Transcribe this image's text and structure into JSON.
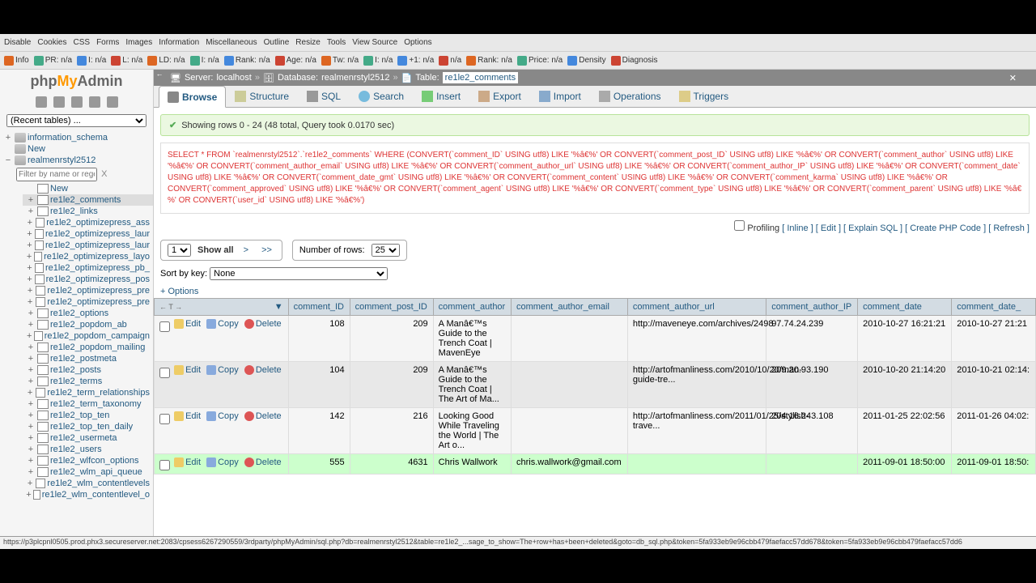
{
  "toolbar1": [
    "Disable",
    "Cookies",
    "CSS",
    "Forms",
    "Images",
    "Information",
    "Miscellaneous",
    "Outline",
    "Resize",
    "Tools",
    "View Source",
    "Options"
  ],
  "toolbar2": [
    {
      "label": "Info"
    },
    {
      "label": "PR: n/a"
    },
    {
      "label": "I: n/a"
    },
    {
      "label": "L: n/a"
    },
    {
      "label": "LD: n/a"
    },
    {
      "label": "I: n/a"
    },
    {
      "label": "Rank: n/a"
    },
    {
      "label": "Age: n/a"
    },
    {
      "label": "Tw: n/a"
    },
    {
      "label": "I: n/a"
    },
    {
      "label": "+1: n/a"
    },
    {
      "label": "n/a"
    },
    {
      "label": "Rank: n/a"
    },
    {
      "label": "Price: n/a"
    },
    {
      "label": "Density"
    },
    {
      "label": "Diagnosis"
    }
  ],
  "logo": {
    "php": "php",
    "my": "My",
    "admin": "Admin"
  },
  "recent_tables": "(Recent tables) ...",
  "tree": {
    "root": [
      {
        "label": "information_schema",
        "kind": "db"
      },
      {
        "label": "New",
        "kind": "new"
      },
      {
        "label": "realmenrstyl2512",
        "kind": "db",
        "expanded": true
      }
    ],
    "filter_placeholder": "Filter by name or regex",
    "filter_x": "X",
    "sub_new": "New",
    "tables": [
      "re1le2_comments",
      "re1le2_links",
      "re1le2_optimizepress_ass",
      "re1le2_optimizepress_laur",
      "re1le2_optimizepress_laur",
      "re1le2_optimizepress_layo",
      "re1le2_optimizepress_pb_",
      "re1le2_optimizepress_pos",
      "re1le2_optimizepress_pre",
      "re1le2_optimizepress_pre",
      "re1le2_options",
      "re1le2_popdom_ab",
      "re1le2_popdom_campaign",
      "re1le2_popdom_mailing",
      "re1le2_postmeta",
      "re1le2_posts",
      "re1le2_terms",
      "re1le2_term_relationships",
      "re1le2_term_taxonomy",
      "re1le2_top_ten",
      "re1le2_top_ten_daily",
      "re1le2_usermeta",
      "re1le2_users",
      "re1le2_wlfcon_options",
      "re1le2_wlm_api_queue",
      "re1le2_wlm_contentlevels",
      "re1le2_wlm_contentlevel_o"
    ],
    "selected": "re1le2_comments"
  },
  "breadcrumb": {
    "server_label": "Server:",
    "server": "localhost",
    "db_label": "Database:",
    "db": "realmenrstyl2512",
    "table_label": "Table:",
    "table": "re1le2_comments"
  },
  "tabs": [
    "Browse",
    "Structure",
    "SQL",
    "Search",
    "Insert",
    "Export",
    "Import",
    "Operations",
    "Triggers"
  ],
  "tab_active": "Browse",
  "success_msg": "Showing rows 0 - 24 (48 total, Query took 0.0170 sec)",
  "sql_query": "SELECT * FROM `realmenrstyl2512`.`re1le2_comments` WHERE (CONVERT(`comment_ID` USING utf8) LIKE '%â€%' OR CONVERT(`comment_post_ID` USING utf8) LIKE '%â€%' OR CONVERT(`comment_author` USING utf8) LIKE '%â€%' OR CONVERT(`comment_author_email` USING utf8) LIKE '%â€%' OR CONVERT(`comment_author_url` USING utf8) LIKE '%â€%' OR CONVERT(`comment_author_IP` USING utf8) LIKE '%â€%' OR CONVERT(`comment_date` USING utf8) LIKE '%â€%' OR CONVERT(`comment_date_gmt` USING utf8) LIKE '%â€%' OR CONVERT(`comment_content` USING utf8) LIKE '%â€%' OR CONVERT(`comment_karma` USING utf8) LIKE '%â€%' OR CONVERT(`comment_approved` USING utf8) LIKE '%â€%' OR CONVERT(`comment_agent` USING utf8) LIKE '%â€%' OR CONVERT(`comment_type` USING utf8) LIKE '%â€%' OR CONVERT(`comment_parent` USING utf8) LIKE '%â€%' OR CONVERT(`user_id` USING utf8) LIKE '%â€%')",
  "sql_actions": {
    "profiling": "Profiling",
    "inline": "Inline",
    "edit": "Edit",
    "explain": "Explain SQL",
    "create_php": "Create PHP Code",
    "refresh": "Refresh"
  },
  "nav": {
    "page": "1",
    "show_all": "Show all",
    "next": ">",
    "last": ">>",
    "num_rows_label": "Number of rows:",
    "num_rows": "25"
  },
  "sort_label": "Sort by key:",
  "sort_value": "None",
  "options_link": "+ Options",
  "columns": [
    "comment_ID",
    "comment_post_ID",
    "comment_author",
    "comment_author_email",
    "comment_author_url",
    "comment_author_IP",
    "comment_date",
    "comment_date_"
  ],
  "row_actions": {
    "edit": "Edit",
    "copy": "Copy",
    "delete": "Delete"
  },
  "rows": [
    {
      "id": "108",
      "post_id": "209",
      "author": "A Manâ€™s Guide to the Trench Coat | MavenEye",
      "email": "",
      "url": "http://maveneye.com/archives/2498",
      "ip": "97.74.24.239",
      "date": "2010-10-27 16:21:21",
      "date_gmt": "2010-10-27 21:21"
    },
    {
      "id": "104",
      "post_id": "209",
      "author": "A Manâ€™s Guide to the Trench Coat | The Art of Ma...",
      "email": "",
      "url": "http://artofmanliness.com/2010/10/20/man-guide-tre...",
      "ip": "209.20.93.190",
      "date": "2010-10-20 21:14:20",
      "date_gmt": "2010-10-21 02:14:"
    },
    {
      "id": "142",
      "post_id": "216",
      "author": "Looking Good While Traveling the World | The Art o...",
      "email": "",
      "url": "http://artofmanliness.com/2011/01/25/stylish-trave...",
      "ip": "204.16.243.108",
      "date": "2011-01-25 22:02:56",
      "date_gmt": "2011-01-26 04:02:"
    },
    {
      "id": "555",
      "post_id": "4631",
      "author": "Chris Wallwork",
      "email": "chris.wallwork@gmail.com",
      "url": "",
      "ip": "",
      "date": "2011-09-01 18:50:00",
      "date_gmt": "2011-09-01 18:50:"
    }
  ],
  "status_url": "https://p3plcpnl0505.prod.phx3.secureserver.net:2083/cpsess6267290559/3rdparty/phpMyAdmin/sql.php?db=realmenrstyl2512&table=re1le2_...sage_to_show=The+row+has+been+deleted&goto=db_sql.php&token=5fa933eb9e96cbb479faefacc57dd678&token=5fa933eb9e96cbb479faefacc57dd6"
}
